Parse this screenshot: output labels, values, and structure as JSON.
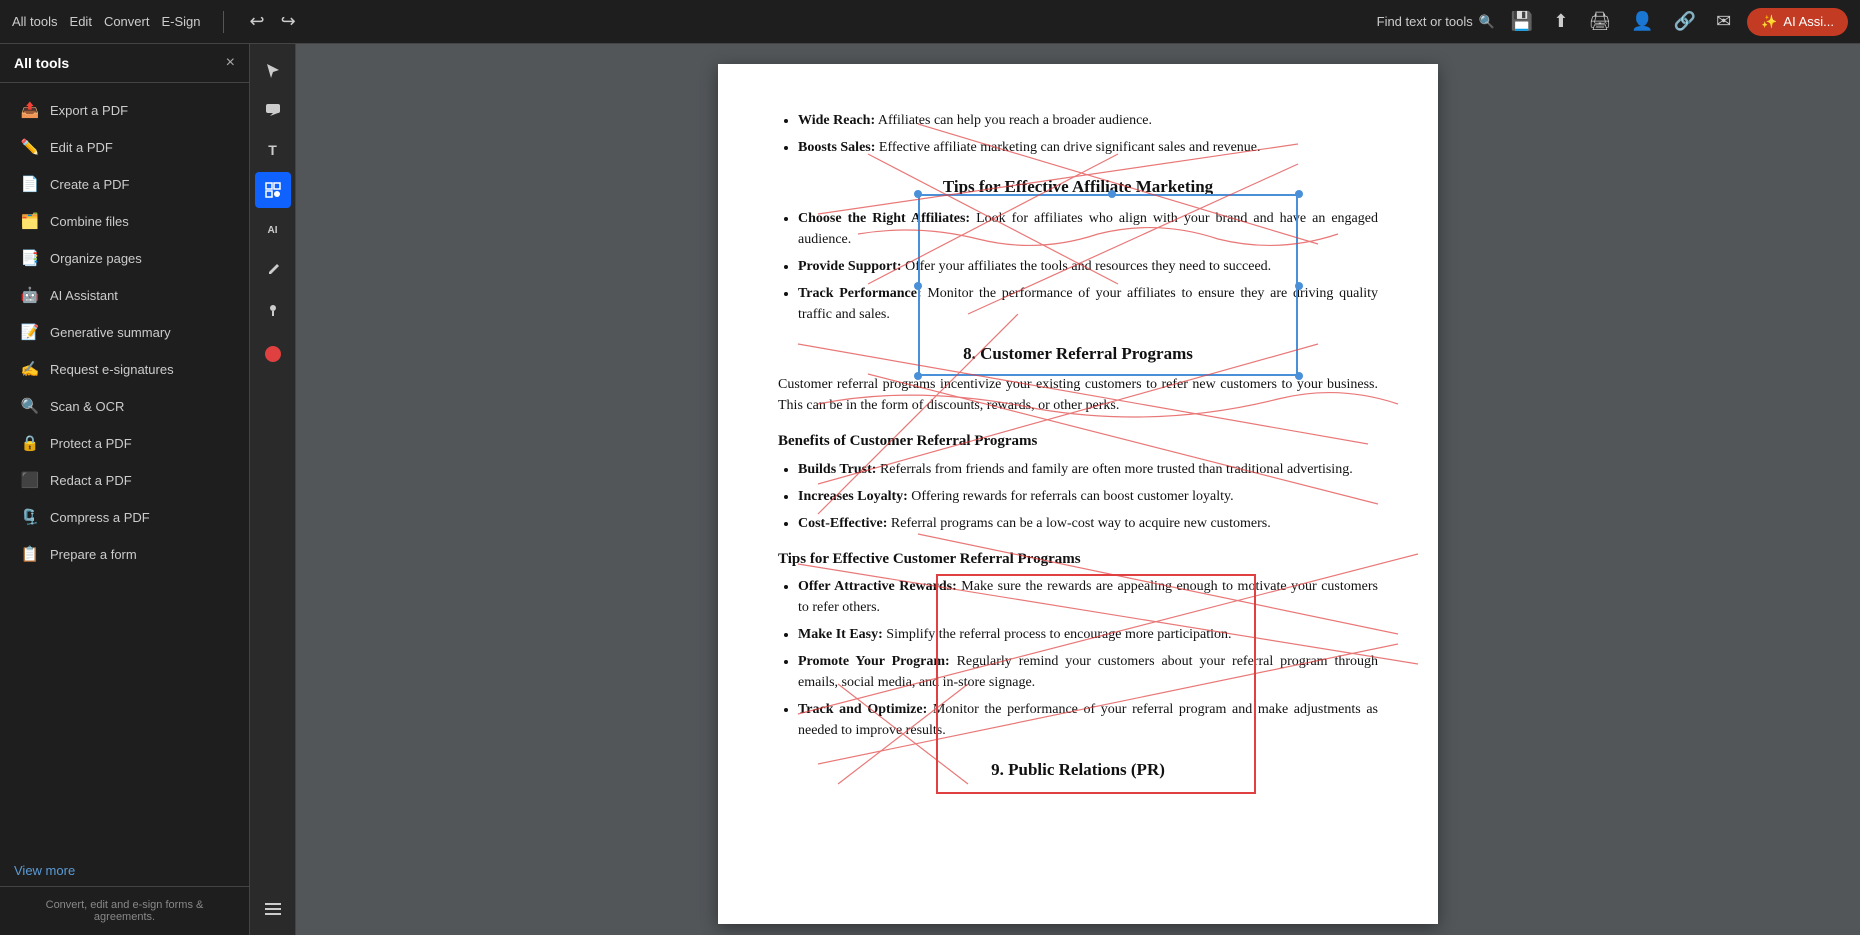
{
  "toolbar": {
    "nav_items": [
      "All tools",
      "Edit",
      "Convert",
      "E-Sign"
    ],
    "find_label": "Find text or tools",
    "ai_button_label": "AI Assi...",
    "undo_icon": "↩",
    "redo_icon": "↪"
  },
  "sidebar": {
    "title": "All tools",
    "close_icon": "×",
    "items": [
      {
        "id": "export-pdf",
        "label": "Export a PDF",
        "icon": "📤",
        "icon_class": "icon-export"
      },
      {
        "id": "edit-pdf",
        "label": "Edit a PDF",
        "icon": "✏️",
        "icon_class": "icon-edit"
      },
      {
        "id": "create-pdf",
        "label": "Create a PDF",
        "icon": "📄",
        "icon_class": "icon-create"
      },
      {
        "id": "combine-files",
        "label": "Combine files",
        "icon": "🗂️",
        "icon_class": "icon-combine"
      },
      {
        "id": "organize-pages",
        "label": "Organize pages",
        "icon": "📑",
        "icon_class": "icon-organize"
      },
      {
        "id": "ai-assistant",
        "label": "AI Assistant",
        "icon": "🤖",
        "icon_class": "icon-ai"
      },
      {
        "id": "generative-summary",
        "label": "Generative summary",
        "icon": "📝",
        "icon_class": "icon-summary"
      },
      {
        "id": "request-esignatures",
        "label": "Request e-signatures",
        "icon": "✍️",
        "icon_class": "icon-esign"
      },
      {
        "id": "scan-ocr",
        "label": "Scan & OCR",
        "icon": "🔍",
        "icon_class": "icon-scan"
      },
      {
        "id": "protect-pdf",
        "label": "Protect a PDF",
        "icon": "🔒",
        "icon_class": "icon-protect"
      },
      {
        "id": "redact-pdf",
        "label": "Redact a PDF",
        "icon": "⬛",
        "icon_class": "icon-redact"
      },
      {
        "id": "compress-pdf",
        "label": "Compress a PDF",
        "icon": "🗜️",
        "icon_class": "icon-compress"
      },
      {
        "id": "prepare-form",
        "label": "Prepare a form",
        "icon": "📋",
        "icon_class": "icon-form"
      }
    ],
    "view_more_label": "View more",
    "footer_text": "Convert, edit and e-sign forms & agreements."
  },
  "tool_panel": {
    "tools": [
      {
        "id": "cursor",
        "icon": "↖",
        "active": false
      },
      {
        "id": "comment",
        "icon": "💬",
        "active": false
      },
      {
        "id": "text",
        "icon": "T",
        "active": false
      },
      {
        "id": "scan-select",
        "icon": "🔲",
        "active": true
      },
      {
        "id": "ai-tool",
        "icon": "AI",
        "active": false
      },
      {
        "id": "pen",
        "icon": "✒",
        "active": false
      },
      {
        "id": "pin",
        "icon": "📌",
        "active": false
      },
      {
        "id": "record",
        "icon": "●",
        "active": false,
        "is_red": true
      },
      {
        "id": "menu",
        "icon": "≡",
        "active": false
      }
    ]
  },
  "pdf": {
    "sections": [
      {
        "type": "bullets",
        "items": [
          {
            "bold": "Wide Reach:",
            "text": " Affiliates can help you reach a broader audience."
          },
          {
            "bold": "Boosts Sales:",
            "text": " Effective affiliate marketing can drive significant sales and revenue."
          }
        ]
      },
      {
        "type": "heading2",
        "text": "Tips for Effective Affiliate Marketing"
      },
      {
        "type": "bullets",
        "items": [
          {
            "bold": "Choose the Right Affiliates:",
            "text": " Look for affiliates who align with your brand and have an engaged audience."
          },
          {
            "bold": "Provide Support:",
            "text": " Offer your affiliates the tools and resources they need to succeed."
          },
          {
            "bold": "Track Performance:",
            "text": " Monitor the performance of your affiliates to ensure they are driving quality traffic and sales."
          }
        ]
      },
      {
        "type": "heading2",
        "text": "8. Customer Referral Programs"
      },
      {
        "type": "paragraph",
        "text": "Customer referral programs incentivize your existing customers to refer new customers to your business. This can be in the form of discounts, rewards, or other perks."
      },
      {
        "type": "heading3",
        "text": "Benefits of Customer Referral Programs"
      },
      {
        "type": "bullets",
        "items": [
          {
            "bold": "Builds Trust:",
            "text": " Referrals from friends and family are often more trusted than traditional advertising."
          },
          {
            "bold": "Increases Loyalty:",
            "text": " Offering rewards for referrals can boost customer loyalty."
          },
          {
            "bold": "Cost-Effective:",
            "text": " Referral programs can be a low-cost way to acquire new customers."
          }
        ]
      },
      {
        "type": "heading3",
        "text": "Tips for Effective Customer Referral Programs"
      },
      {
        "type": "bullets",
        "items": [
          {
            "bold": "Offer Attractive Rewards:",
            "text": " Make sure the rewards are appealing enough to motivate your customers to refer others."
          },
          {
            "bold": "Make It Easy:",
            "text": " Simplify the referral process to encourage more participation."
          },
          {
            "bold": "Promote Your Program:",
            "text": " Regularly remind your customers about your referral program through emails, social media, and in-store signage."
          },
          {
            "bold": "Track and Optimize:",
            "text": " Monitor the performance of your referral program and make adjustments as needed to improve results."
          }
        ]
      },
      {
        "type": "heading2",
        "text": "9. Public Relations (PR)"
      }
    ]
  }
}
